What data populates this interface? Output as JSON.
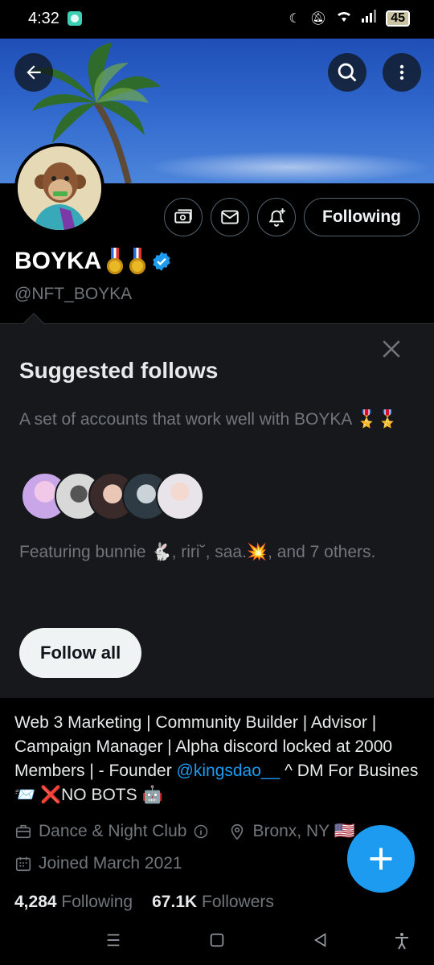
{
  "status_bar": {
    "time": "4:32",
    "battery": "45"
  },
  "header": {
    "back_label": "Back",
    "search_label": "Search",
    "more_label": "More"
  },
  "profile": {
    "name": "BOYKA",
    "handle": "@NFT_BOYKA",
    "following_button": "Following",
    "bio_parts": {
      "text1": "Web 3 Marketing | Community Builder | Advisor | Campaign Manager | Alpha discord locked at 2000 Members | - Founder ",
      "mention": "@kingsdao__",
      "text2": " ^ DM For Busines📨  ❌NO BOTS 🤖"
    },
    "category": "Dance & Night Club",
    "location": "Bronx, NY 🇺🇸",
    "joined": "Joined March 2021",
    "following_count": "4,284",
    "following_label": "Following",
    "followers_count": "67.1K",
    "followers_label": "Followers"
  },
  "suggested": {
    "title": "Suggested follows",
    "description": "A set of accounts that work well with BOYKA 🎖️🎖️",
    "featuring": "Featuring bunnie 🐇, riri˘, saa.💥, and 7 others.",
    "follow_all": "Follow all",
    "avatar_colors": [
      "#c9a6e8",
      "#d8d8d8",
      "#b58a86",
      "#4a5a66",
      "#e9e4ea"
    ]
  },
  "colors": {
    "accent": "#1d9bf0",
    "background": "#000000",
    "card": "#16181c"
  }
}
